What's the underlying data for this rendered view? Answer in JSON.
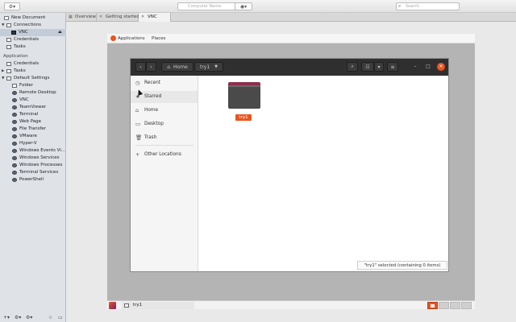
{
  "toolbar": {
    "computer_name_placeholder": "Computer Name",
    "search_placeholder": "Search",
    "icons": {
      "menu": "gear-icon",
      "connect": "play-circle-icon",
      "search": "search-icon"
    }
  },
  "sidebar": {
    "rows": [
      {
        "label": "New Document",
        "icon": "document-icon"
      },
      {
        "label": "Connections",
        "icon": "folder-icon"
      },
      {
        "label": "VNC",
        "icon": "monitor-icon"
      },
      {
        "label": "Credentials",
        "icon": "folder-icon"
      },
      {
        "label": "Tasks",
        "icon": "folder-icon"
      },
      {
        "label": "Application"
      },
      {
        "label": "Credentials",
        "icon": "folder-icon"
      },
      {
        "label": "Tasks",
        "icon": "folder-icon"
      },
      {
        "label": "Default Settings",
        "icon": "folder-icon"
      },
      {
        "label": "Folder",
        "icon": "folder-icon"
      },
      {
        "label": "Remote Desktop",
        "icon": "globe-icon"
      },
      {
        "label": "VNC",
        "icon": "globe-icon"
      },
      {
        "label": "TeamViewer",
        "icon": "globe-icon"
      },
      {
        "label": "Terminal",
        "icon": "globe-icon"
      },
      {
        "label": "Web Page",
        "icon": "globe-icon"
      },
      {
        "label": "File Transfer",
        "icon": "globe-icon"
      },
      {
        "label": "VMware",
        "icon": "globe-icon"
      },
      {
        "label": "Hyper-V",
        "icon": "globe-icon"
      },
      {
        "label": "Windows Events Vi...",
        "icon": "globe-icon"
      },
      {
        "label": "Windows Services",
        "icon": "globe-icon"
      },
      {
        "label": "Windows Processes",
        "icon": "globe-icon"
      },
      {
        "label": "Terminal Services",
        "icon": "globe-icon"
      },
      {
        "label": "PowerShell",
        "icon": "globe-icon"
      }
    ],
    "footer_icons": [
      "add-icon",
      "settings-icon",
      "options-icon",
      "star-icon",
      "folder-icon"
    ]
  },
  "tabs": [
    {
      "label": "Overview"
    },
    {
      "label": "Getting started"
    },
    {
      "label": "VNC",
      "active": true
    }
  ],
  "remote": {
    "gnome_bar": {
      "applications": "Applications",
      "places": "Places"
    },
    "nautilus": {
      "breadcrumbs": [
        "Home",
        "try1"
      ],
      "sidebar": [
        {
          "label": "Recent",
          "icon": "clock-icon"
        },
        {
          "label": "Starred",
          "icon": "star-icon"
        },
        {
          "label": "Home",
          "icon": "home-icon"
        },
        {
          "label": "Desktop",
          "icon": "desktop-icon"
        },
        {
          "label": "Trash",
          "icon": "trash-icon"
        },
        {
          "label": "Other Locations",
          "icon": "plus-icon"
        }
      ],
      "folder": {
        "name": "try1"
      },
      "status": "\"try1\" selected (containing 0 items)"
    },
    "taskbar": {
      "task_label": "try1"
    }
  },
  "colors": {
    "accent": "#e95420",
    "header": "#2f2f2f",
    "sidebar_bg": "#dfe3e8"
  }
}
